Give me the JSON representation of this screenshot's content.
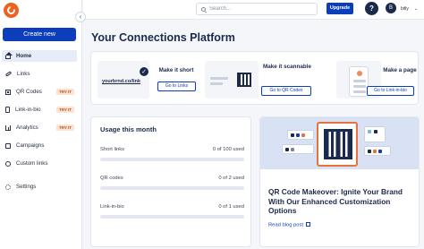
{
  "sidebar": {
    "create_label": "Create new",
    "items": [
      {
        "label": "Home",
        "icon": "home-icon",
        "badge": ""
      },
      {
        "label": "Links",
        "icon": "link-icon",
        "badge": ""
      },
      {
        "label": "QR Codes",
        "icon": "qr-code-icon",
        "badge": "TRY IT"
      },
      {
        "label": "Link-in-bio",
        "icon": "link-in-bio-icon",
        "badge": "TRY IT"
      },
      {
        "label": "Analytics",
        "icon": "analytics-icon",
        "badge": "TRY IT"
      },
      {
        "label": "Campaigns",
        "icon": "campaigns-icon",
        "badge": ""
      },
      {
        "label": "Custom links",
        "icon": "custom-links-icon",
        "badge": ""
      },
      {
        "label": "Settings",
        "icon": "settings-icon",
        "badge": ""
      }
    ]
  },
  "header": {
    "search_placeholder": "Search...",
    "upgrade_label": "Upgrade",
    "help_label": "?",
    "avatar_initial": "B",
    "username": "bitly"
  },
  "main": {
    "title": "Your Connections Platform",
    "cards": [
      {
        "title": "Make it short",
        "button": "Go to Links",
        "sample_url": "yourbrnd.co/link"
      },
      {
        "title": "Make it scannable",
        "button": "Go to QR Codes"
      },
      {
        "title": "Make a page",
        "button": "Go to Link-in-bio"
      }
    ],
    "usage": {
      "title": "Usage this month",
      "rows": [
        {
          "label": "Short links",
          "count": "0 of 100 used",
          "fraction": 0
        },
        {
          "label": "QR codes",
          "count": "0 of 2 used",
          "fraction": 0
        },
        {
          "label": "Link-in-bio",
          "count": "0 of 1 used",
          "fraction": 0
        }
      ]
    },
    "promo": {
      "title": "QR Code Makeover: Ignite Your Brand With Our Enhanced Customization Options",
      "link": "Read blog post"
    }
  },
  "colors": {
    "brand_blue": "#0c3ebb",
    "brand_orange": "#ee6123",
    "navy": "#1b2a4a",
    "try_badge_bg": "#fbe2d3"
  }
}
